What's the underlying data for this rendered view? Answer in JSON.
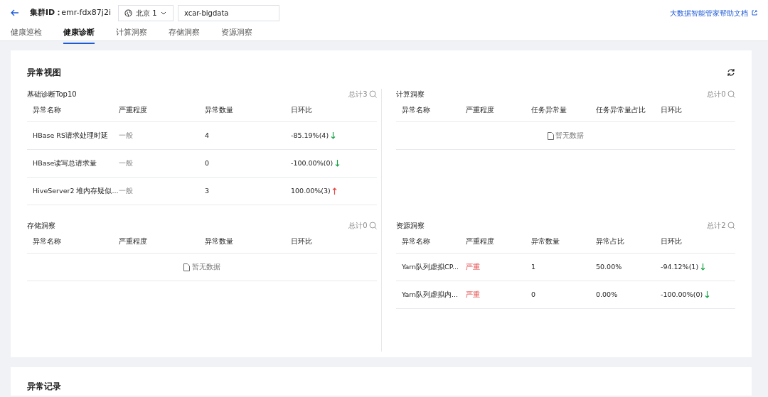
{
  "header": {
    "cluster_label": "集群ID：",
    "cluster_id": "emr-fdx87j2i",
    "region": "北京 1",
    "cluster_name": "xcar-bigdata",
    "help_link": "大数据智能管家帮助文档"
  },
  "tabs": [
    {
      "label": "健康巡检",
      "selected": false
    },
    {
      "label": "健康诊断",
      "selected": true
    },
    {
      "label": "计算洞察",
      "selected": false
    },
    {
      "label": "存储洞察",
      "selected": false
    },
    {
      "label": "资源洞察",
      "selected": false
    }
  ],
  "overview": {
    "title": "异常视图",
    "panels": [
      {
        "title": "基础诊断Top10",
        "total": "总计3",
        "columns": [
          "异常名称",
          "严重程度",
          "异常数量",
          "日环比"
        ],
        "rows": [
          {
            "name": "HBase RS请求处理时延",
            "severity": {
              "text": "一般",
              "serious": false
            },
            "values": [
              "4"
            ],
            "change": "-85.19%(4)",
            "rising": false
          },
          {
            "name": "HBase读写总请求量",
            "severity": {
              "text": "一般",
              "serious": false
            },
            "values": [
              "0"
            ],
            "change": "-100.00%(0)",
            "rising": false
          },
          {
            "name": "HiveServer2 堆内存疑似...",
            "severity": {
              "text": "一般",
              "serious": false
            },
            "values": [
              "3"
            ],
            "change": "100.00%(3)",
            "rising": true
          }
        ]
      },
      {
        "title": "计算洞察",
        "total": "总计0",
        "columns": [
          "异常名称",
          "严重程度",
          "任务异常量",
          "任务异常量占比",
          "日环比"
        ],
        "empty": "暂无数据"
      },
      {
        "title": "存储洞察",
        "total": "总计0",
        "columns": [
          "异常名称",
          "严重程度",
          "异常数量",
          "日环比"
        ],
        "empty": "暂无数据"
      },
      {
        "title": "资源洞察",
        "total": "总计2",
        "columns": [
          "异常名称",
          "严重程度",
          "异常数量",
          "异常占比",
          "日环比"
        ],
        "rows": [
          {
            "name": "Yarn队列虚拟CP...",
            "severity": {
              "text": "严重",
              "serious": true
            },
            "values": [
              "1",
              "50.00%"
            ],
            "change": "-94.12%(1)",
            "rising": false
          },
          {
            "name": "Yarn队列虚拟内...",
            "severity": {
              "text": "严重",
              "serious": true
            },
            "values": [
              "0",
              "0.00%"
            ],
            "change": "-100.00%(0)",
            "rising": false
          }
        ]
      }
    ]
  },
  "records": {
    "title": "异常记录"
  }
}
